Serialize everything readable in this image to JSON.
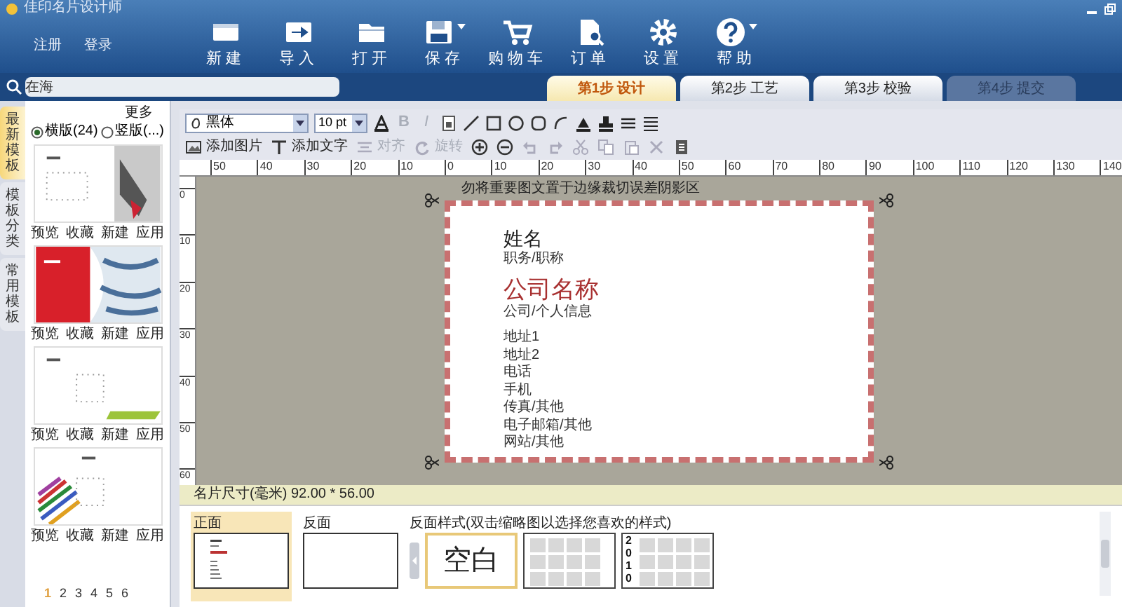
{
  "window": {
    "title": "佳印名片设计师"
  },
  "account_links": [
    "注册",
    "登录"
  ],
  "toolbar": [
    {
      "label": "新建",
      "kind": "new",
      "menu": false
    },
    {
      "label": "导入",
      "kind": "import",
      "menu": false
    },
    {
      "label": "打开",
      "kind": "open",
      "menu": false
    },
    {
      "label": "保存",
      "kind": "save",
      "menu": true
    },
    {
      "label": "购物车",
      "kind": "cart",
      "menu": false
    },
    {
      "label": "订单",
      "kind": "order",
      "menu": false
    },
    {
      "label": "设置",
      "kind": "settings",
      "menu": false
    },
    {
      "label": "帮助",
      "kind": "help",
      "menu": true
    }
  ],
  "search": {
    "placeholder": "在海"
  },
  "steps": [
    {
      "label": "第1步 设计",
      "selected": true,
      "disabled": false
    },
    {
      "label": "第2步 工艺",
      "selected": false,
      "disabled": false
    },
    {
      "label": "第3步 校验",
      "selected": false,
      "disabled": false
    },
    {
      "label": "第4步 提交",
      "selected": false,
      "disabled": true
    }
  ],
  "side_tabs": [
    {
      "label": "最新模板",
      "selected": true
    },
    {
      "label": "模板分类",
      "selected": false
    },
    {
      "label": "常用模板",
      "selected": false
    }
  ],
  "templates": {
    "more": "更多",
    "orientations": [
      {
        "label": "横版(24)",
        "selected": true
      },
      {
        "label": "竖版(...)",
        "selected": false
      }
    ],
    "items": [
      {
        "kind": "ink",
        "actions": [
          "预览",
          "收藏",
          "新建",
          "应用"
        ]
      },
      {
        "kind": "red",
        "actions": [
          "预览",
          "收藏",
          "新建",
          "应用"
        ]
      },
      {
        "kind": "green",
        "actions": [
          "预览",
          "收藏",
          "新建",
          "应用"
        ]
      },
      {
        "kind": "pencils",
        "actions": [
          "预览",
          "收藏",
          "新建",
          "应用"
        ]
      }
    ],
    "pages": [
      {
        "label": "1",
        "selected": true
      },
      {
        "label": "2",
        "selected": false
      },
      {
        "label": "3",
        "selected": false
      },
      {
        "label": "4",
        "selected": false
      },
      {
        "label": "5",
        "selected": false
      },
      {
        "label": "6",
        "selected": false
      }
    ]
  },
  "editor_toolbar": {
    "font": "黑体",
    "size": "10 pt",
    "styles": [
      {
        "label": "B",
        "disabled": true
      },
      {
        "label": "I",
        "disabled": true
      }
    ],
    "actions": [
      {
        "label": "添加图片",
        "kind": "image",
        "disabled": false
      },
      {
        "label": "添加文字",
        "kind": "text",
        "disabled": false
      },
      {
        "label": "对齐",
        "kind": "align",
        "disabled": true
      },
      {
        "label": "旋转",
        "kind": "rotate",
        "disabled": true
      }
    ]
  },
  "ruler": {
    "horizontal": [
      "50",
      "40",
      "30",
      "20",
      "10",
      "0",
      "10",
      "20",
      "30",
      "40",
      "50",
      "60",
      "70",
      "80",
      "90",
      "100",
      "110",
      "120",
      "130",
      "140"
    ],
    "vertical": [
      "0",
      "10",
      "20",
      "30",
      "40",
      "50",
      "60"
    ]
  },
  "canvas": {
    "notice": "勿将重要图文置于边缘裁切误差阴影区",
    "card": {
      "name": "姓名",
      "title": "职务/职称",
      "company": "公司名称",
      "info": "公司/个人信息",
      "lines": [
        "地址1",
        "地址2",
        "电话",
        "手机",
        "传真/其他",
        "电子邮箱/其他",
        "网站/其他"
      ]
    }
  },
  "status_bar": "名片尺寸(毫米) 92.00 * 56.00",
  "faces": [
    {
      "label": "正面",
      "kind": "front",
      "selected": true
    },
    {
      "label": "反面",
      "kind": "back",
      "selected": false
    }
  ],
  "back_styles": {
    "label": "反面样式(双击缩略图以选择您喜欢的样式)",
    "items": [
      {
        "kind": "blank",
        "text": "空白",
        "selected": true
      },
      {
        "kind": "calendar",
        "selected": false
      },
      {
        "kind": "calendar_year",
        "text": "2010",
        "selected": false
      }
    ]
  }
}
